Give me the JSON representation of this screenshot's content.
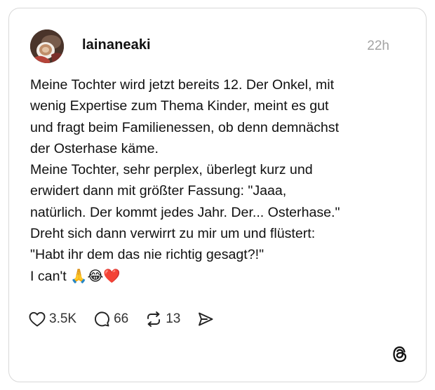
{
  "post": {
    "username": "lainaneaki",
    "timestamp": "22h",
    "lines": [
      "Meine Tochter wird jetzt bereits 12. Der Onkel, mit",
      "wenig Expertise zum Thema Kinder, meint es gut",
      "und fragt beim Familienessen, ob denn demnächst",
      "der Osterhase käme.",
      "Meine Tochter, sehr perplex, überlegt kurz und",
      "erwidert dann mit größter Fassung: \"Jaaa,",
      "natürlich. Der kommt jedes Jahr. Der... Osterhase.\"",
      "Dreht sich dann verwirrt zu mir um und flüstert:",
      "\"Habt ihr dem das nie richtig gesagt?!\"",
      "I can't 🙏😂❤️"
    ]
  },
  "actions": {
    "likes": "3.5K",
    "replies": "66",
    "reposts": "13"
  },
  "icons": {
    "like": "heart-icon",
    "reply": "speech-bubble-icon",
    "repost": "repost-arrows-icon",
    "share": "send-icon",
    "brand": "threads-logo-icon"
  },
  "colors": {
    "border": "#d8d8d8",
    "timestamp": "#a3a3a3",
    "text": "#111111"
  }
}
